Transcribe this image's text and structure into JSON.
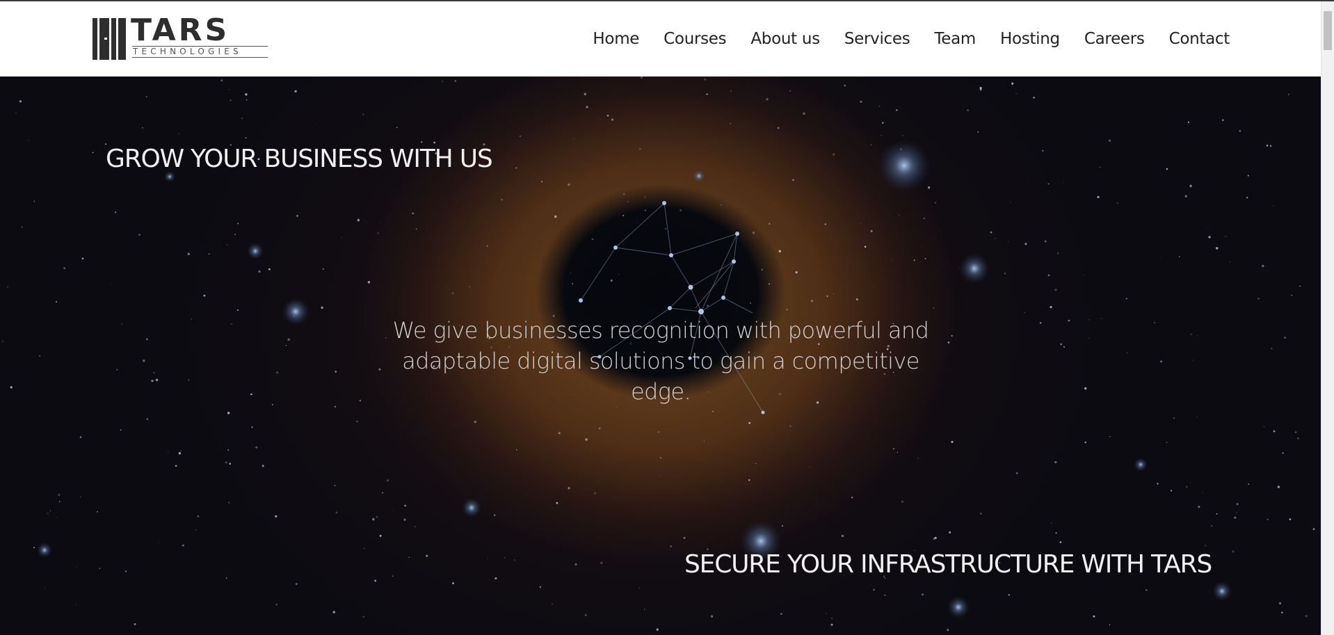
{
  "brand": {
    "name": "TARS",
    "tagline": "TECHNOLOGIES"
  },
  "nav": {
    "items": [
      {
        "label": "Home"
      },
      {
        "label": "Courses"
      },
      {
        "label": "About us"
      },
      {
        "label": "Services"
      },
      {
        "label": "Team"
      },
      {
        "label": "Hosting"
      },
      {
        "label": "Careers"
      },
      {
        "label": "Contact"
      }
    ]
  },
  "hero": {
    "headline_1": "GROW YOUR BUSINESS WITH US",
    "tagline": "We give businesses recognition with powerful and adaptable digital solutions to gain a competitive edge.",
    "headline_2": "SECURE YOUR INFRASTRUCTURE WITH TARS"
  },
  "colors": {
    "header_bg": "#ffffff",
    "nav_text": "#222222",
    "hero_bg": "#0c0b12",
    "nebula": "#8a5a2a",
    "hero_text": "#f1f1f1"
  }
}
